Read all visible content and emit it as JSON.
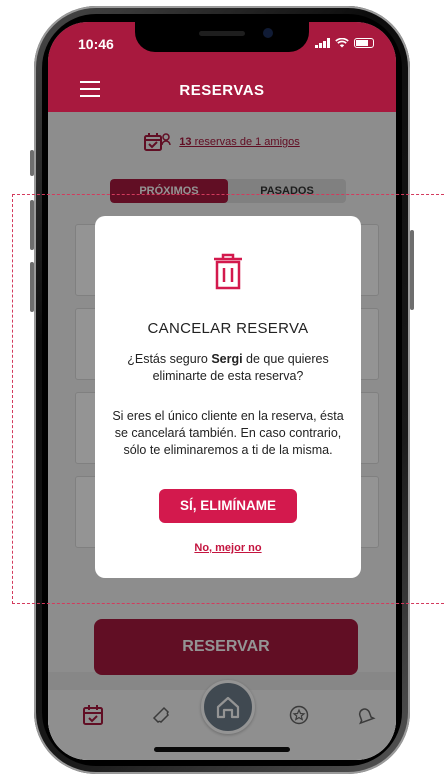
{
  "status_bar": {
    "time": "10:46"
  },
  "app_bar": {
    "title": "RESERVAS"
  },
  "summary": {
    "count": "13",
    "text": " reservas de 1 amigos"
  },
  "tabs": [
    {
      "label": "PRÓXIMOS",
      "active": true
    },
    {
      "label": "PASADOS",
      "active": false
    }
  ],
  "modal": {
    "title": "CANCELAR RESERVA",
    "question_prefix": "¿Estás seguro ",
    "user_name": "Sergi",
    "question_suffix": " de que quieres eliminarte de esta reserva?",
    "description": "Si eres el único cliente en la reserva, ésta se cancelará también. En caso contrario, sólo te eliminaremos a ti de la misma.",
    "confirm_label": "SÍ, ELIMÍNAME",
    "cancel_label": "No, mejor no"
  },
  "reserve_button": {
    "label": "RESERVAR"
  },
  "tab_bar": {
    "items": [
      {
        "icon": "calendar-icon",
        "active": true
      },
      {
        "icon": "ticket-icon",
        "active": false
      },
      {
        "icon": "home-icon",
        "active": false
      },
      {
        "icon": "star-badge-icon",
        "active": false
      },
      {
        "icon": "bell-icon",
        "active": false
      }
    ]
  },
  "colors": {
    "brand": "#a8193e",
    "accent": "#d3194d",
    "overlay": "rgba(0,0,0,0.42)"
  }
}
